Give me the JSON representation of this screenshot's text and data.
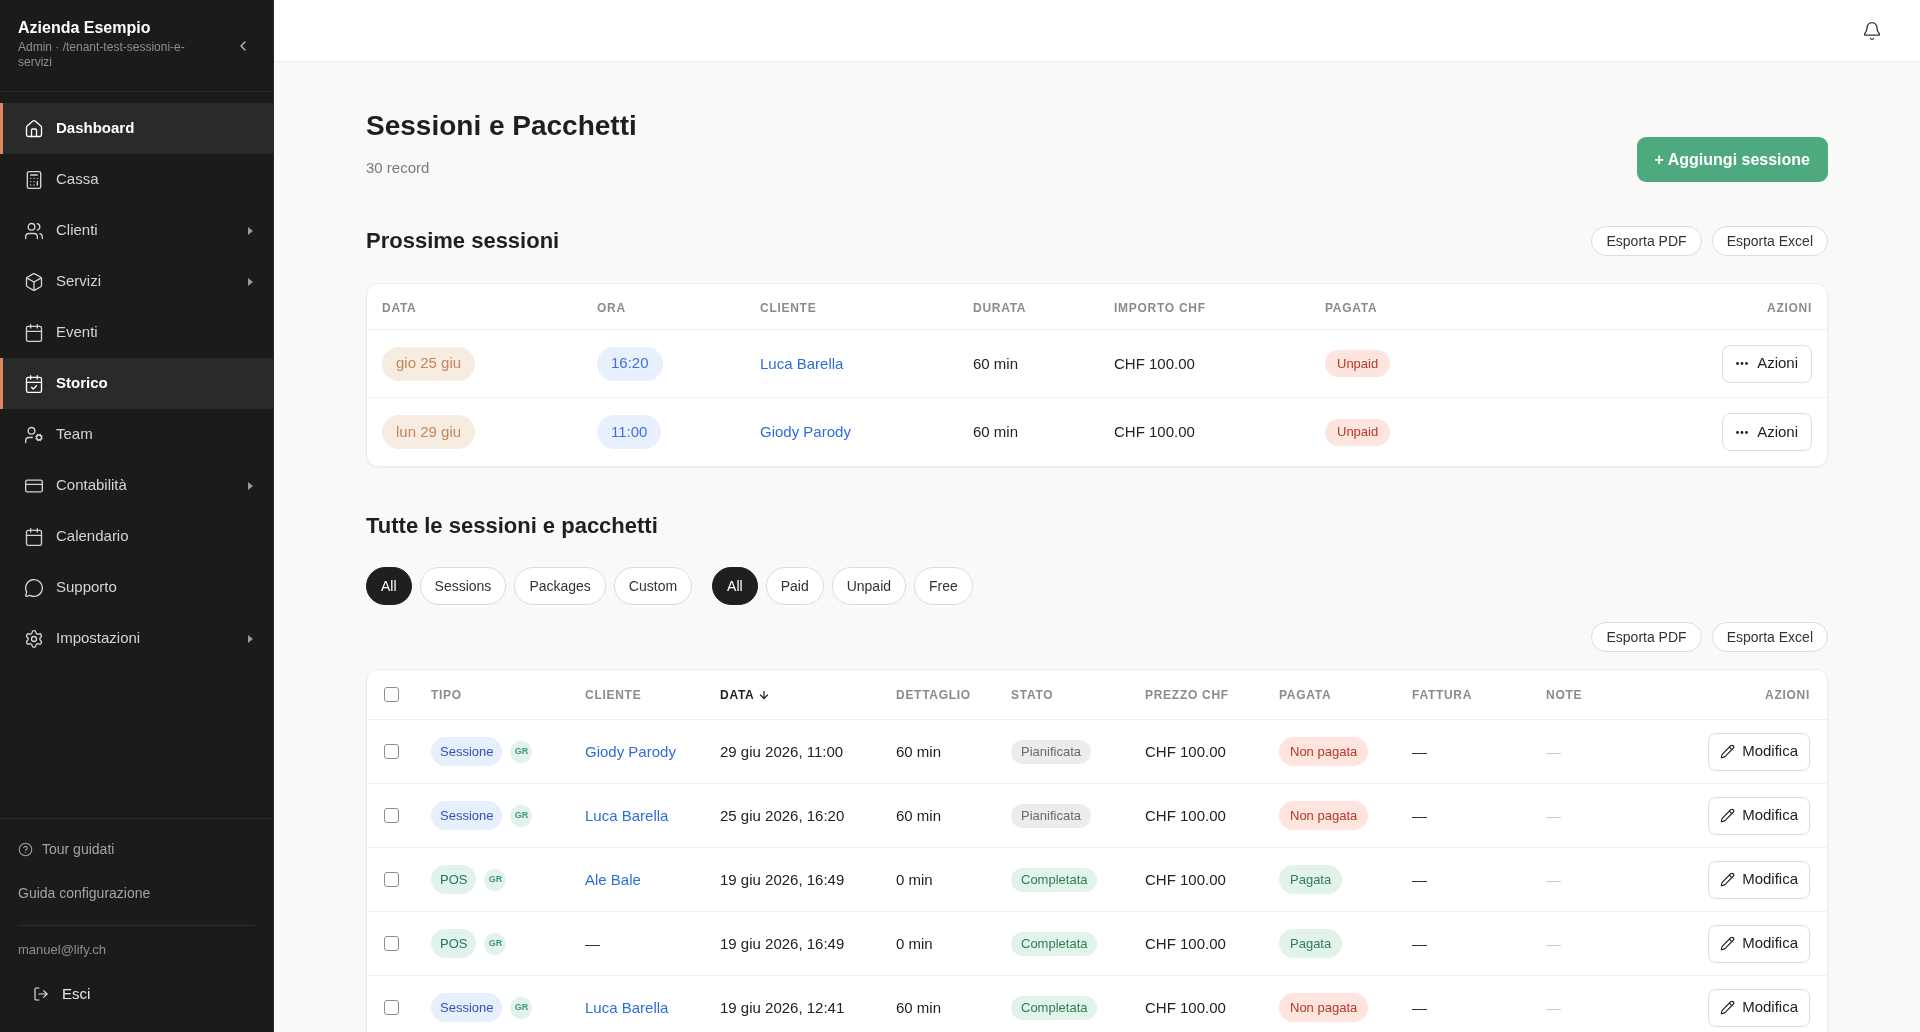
{
  "sidebar": {
    "company": "Azienda Esempio",
    "subtitle": "Admin · /tenant-test-sessioni-e-servizi",
    "nav": [
      {
        "label": "Dashboard",
        "selected": true,
        "has_submenu": false
      },
      {
        "label": "Cassa",
        "selected": false,
        "has_submenu": false
      },
      {
        "label": "Clienti",
        "selected": false,
        "has_submenu": true
      },
      {
        "label": "Servizi",
        "selected": false,
        "has_submenu": true
      },
      {
        "label": "Eventi",
        "selected": false,
        "has_submenu": false
      },
      {
        "label": "Storico",
        "selected": true,
        "has_submenu": false
      },
      {
        "label": "Team",
        "selected": false,
        "has_submenu": false
      },
      {
        "label": "Contabilità",
        "selected": false,
        "has_submenu": true
      },
      {
        "label": "Calendario",
        "selected": false,
        "has_submenu": false
      },
      {
        "label": "Supporto",
        "selected": false,
        "has_submenu": false
      },
      {
        "label": "Impostazioni",
        "selected": false,
        "has_submenu": true
      }
    ],
    "tour_link": "Tour guidati",
    "setup_link": "Guida configurazione",
    "user_email": "manuel@lify.ch",
    "logout": "Esci"
  },
  "page": {
    "title": "Sessioni e Pacchetti",
    "record_count": "30 record",
    "add_button": "+ Aggiungi sessione"
  },
  "upcoming": {
    "title": "Prossime sessioni",
    "export_buttons": [
      "Esporta PDF",
      "Esporta Excel"
    ],
    "columns": [
      "DATA",
      "ORA",
      "CLIENTE",
      "DURATA",
      "IMPORTO CHF",
      "PAGATA",
      "AZIONI"
    ],
    "rows": [
      {
        "date": "gio 25 giu",
        "time": "16:20",
        "client": "Luca Barella",
        "duration": "60 min",
        "amount": "CHF 100.00",
        "paid": {
          "label": "Unpaid",
          "kind": "unpaid"
        },
        "action": "Azioni"
      },
      {
        "date": "lun 29 giu",
        "time": "11:00",
        "client": "Giody Parody",
        "duration": "60 min",
        "amount": "CHF 100.00",
        "paid": {
          "label": "Unpaid",
          "kind": "unpaid"
        },
        "action": "Azioni"
      }
    ]
  },
  "all_sessions": {
    "title": "Tutte le sessioni e pacchetti",
    "type_filters": [
      {
        "label": "All",
        "selected": true
      },
      {
        "label": "Sessions",
        "selected": false
      },
      {
        "label": "Packages",
        "selected": false
      },
      {
        "label": "Custom",
        "selected": false
      }
    ],
    "payment_filters": [
      {
        "label": "All",
        "selected": true
      },
      {
        "label": "Paid",
        "selected": false
      },
      {
        "label": "Unpaid",
        "selected": false
      },
      {
        "label": "Free",
        "selected": false
      }
    ],
    "export_buttons": [
      "Esporta PDF",
      "Esporta Excel"
    ],
    "table": {
      "select_all_checked": false,
      "columns": [
        {
          "label": "TIPO",
          "sorted": false
        },
        {
          "label": "CLIENTE",
          "sorted": false
        },
        {
          "label": "DATA",
          "sorted": true
        },
        {
          "label": "DETTAGLIO",
          "sorted": false
        },
        {
          "label": "STATO",
          "sorted": false
        },
        {
          "label": "PREZZO CHF",
          "sorted": false
        },
        {
          "label": "PAGATA",
          "sorted": false
        },
        {
          "label": "FATTURA",
          "sorted": false
        },
        {
          "label": "NOTE",
          "sorted": false
        },
        {
          "label": "AZIONI",
          "sorted": false
        }
      ],
      "rows": [
        {
          "checked": false,
          "type": {
            "label": "Sessione",
            "kind": "session"
          },
          "tag": "GR",
          "client": "Giody Parody",
          "client_linked": true,
          "date": "29 giu 2026, 11:00",
          "detail": "60 min",
          "status": {
            "label": "Pianificata",
            "kind": "planned"
          },
          "price": "CHF 100.00",
          "paid": {
            "label": "Non pagata",
            "kind": "unpaid"
          },
          "invoice": "—",
          "note": "—",
          "action": "Modifica"
        },
        {
          "checked": false,
          "type": {
            "label": "Sessione",
            "kind": "session"
          },
          "tag": "GR",
          "client": "Luca Barella",
          "client_linked": true,
          "date": "25 giu 2026, 16:20",
          "detail": "60 min",
          "status": {
            "label": "Pianificata",
            "kind": "planned"
          },
          "price": "CHF 100.00",
          "paid": {
            "label": "Non pagata",
            "kind": "unpaid"
          },
          "invoice": "—",
          "note": "—",
          "action": "Modifica"
        },
        {
          "checked": false,
          "type": {
            "label": "POS",
            "kind": "pos"
          },
          "tag": "GR",
          "client": "Ale Bale",
          "client_linked": true,
          "date": "19 giu 2026, 16:49",
          "detail": "0 min",
          "status": {
            "label": "Completata",
            "kind": "completed"
          },
          "price": "CHF 100.00",
          "paid": {
            "label": "Pagata",
            "kind": "paid"
          },
          "invoice": "—",
          "note": "—",
          "action": "Modifica"
        },
        {
          "checked": false,
          "type": {
            "label": "POS",
            "kind": "pos"
          },
          "tag": "GR",
          "client": "—",
          "client_linked": false,
          "date": "19 giu 2026, 16:49",
          "detail": "0 min",
          "status": {
            "label": "Completata",
            "kind": "completed"
          },
          "price": "CHF 100.00",
          "paid": {
            "label": "Pagata",
            "kind": "paid"
          },
          "invoice": "—",
          "note": "—",
          "action": "Modifica"
        },
        {
          "checked": false,
          "type": {
            "label": "Sessione",
            "kind": "session"
          },
          "tag": "GR",
          "client": "Luca Barella",
          "client_linked": true,
          "date": "19 giu 2026, 12:41",
          "detail": "60 min",
          "status": {
            "label": "Completata",
            "kind": "completed"
          },
          "price": "CHF 100.00",
          "paid": {
            "label": "Non pagata",
            "kind": "unpaid"
          },
          "invoice": "—",
          "note": "—",
          "action": "Modifica"
        }
      ]
    }
  }
}
